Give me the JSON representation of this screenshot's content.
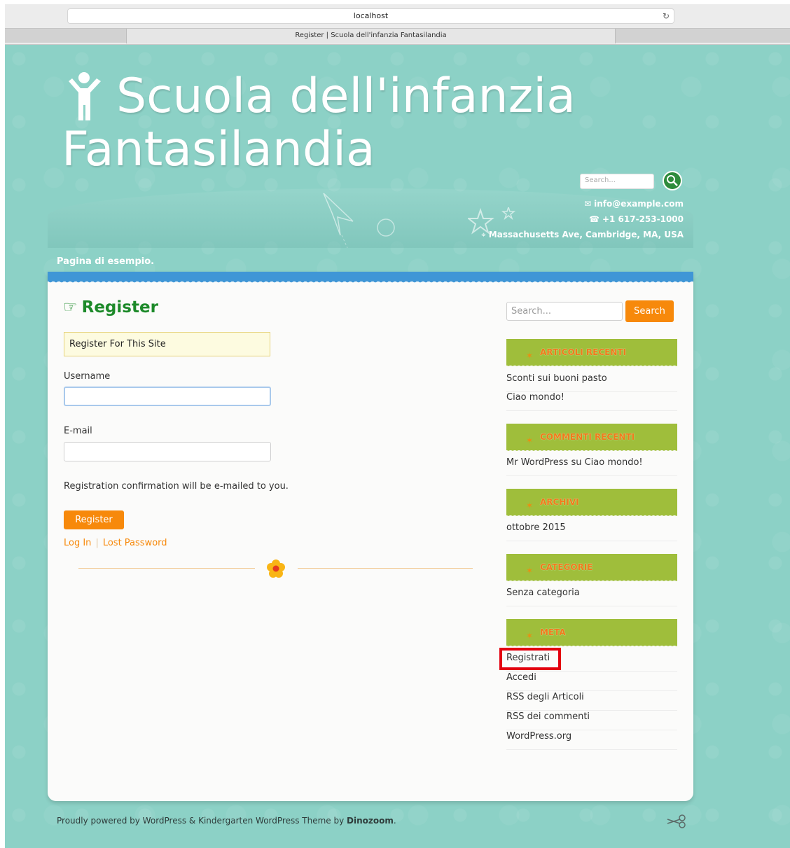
{
  "browser": {
    "url": "localhost",
    "tab_title": "Register | Scuola dell'infanzia Fantasilandia"
  },
  "header": {
    "site_title": "Scuola dell'infanzia Fantasilandia",
    "search_placeholder": "Search...",
    "email": "info@example.com",
    "phone": "+1 617-253-1000",
    "address": "Massachusetts Ave, Cambridge, MA, USA",
    "subnav": "Pagina di esempio."
  },
  "register": {
    "title": "Register",
    "notice": "Register For This Site",
    "username_label": "Username",
    "email_label": "E-mail",
    "note": "Registration confirmation will be e-mailed to you.",
    "button": "Register",
    "login_link": "Log In",
    "separator": "|",
    "lost_password_link": "Lost Password"
  },
  "sidebar": {
    "search_placeholder": "Search...",
    "search_button": "Search",
    "widgets": [
      {
        "title": "ARTICOLI RECENTI",
        "items": [
          "Sconti sui buoni pasto",
          "Ciao mondo!"
        ]
      },
      {
        "title": "COMMENTI RECENTI",
        "items": [
          "Mr WordPress su Ciao mondo!"
        ]
      },
      {
        "title": "ARCHIVI",
        "items": [
          "ottobre 2015"
        ]
      },
      {
        "title": "CATEGORIE",
        "items": [
          "Senza categoria"
        ]
      },
      {
        "title": "META",
        "items": [
          "Registrati",
          "Accedi",
          "RSS degli Articoli",
          "RSS dei commenti",
          "WordPress.org"
        ]
      }
    ]
  },
  "footer": {
    "text_prefix": "Proudly powered by WordPress & Kindergarten WordPress Theme by ",
    "author": "Dinozoom",
    "suffix": "."
  },
  "colors": {
    "background": "#8cd1c6",
    "accent_orange": "#f7890b",
    "title_green": "#1d8a2a",
    "widget_green": "#9fbe3b",
    "panel_blue": "#3f96d6",
    "highlight_red": "#e3000f"
  }
}
